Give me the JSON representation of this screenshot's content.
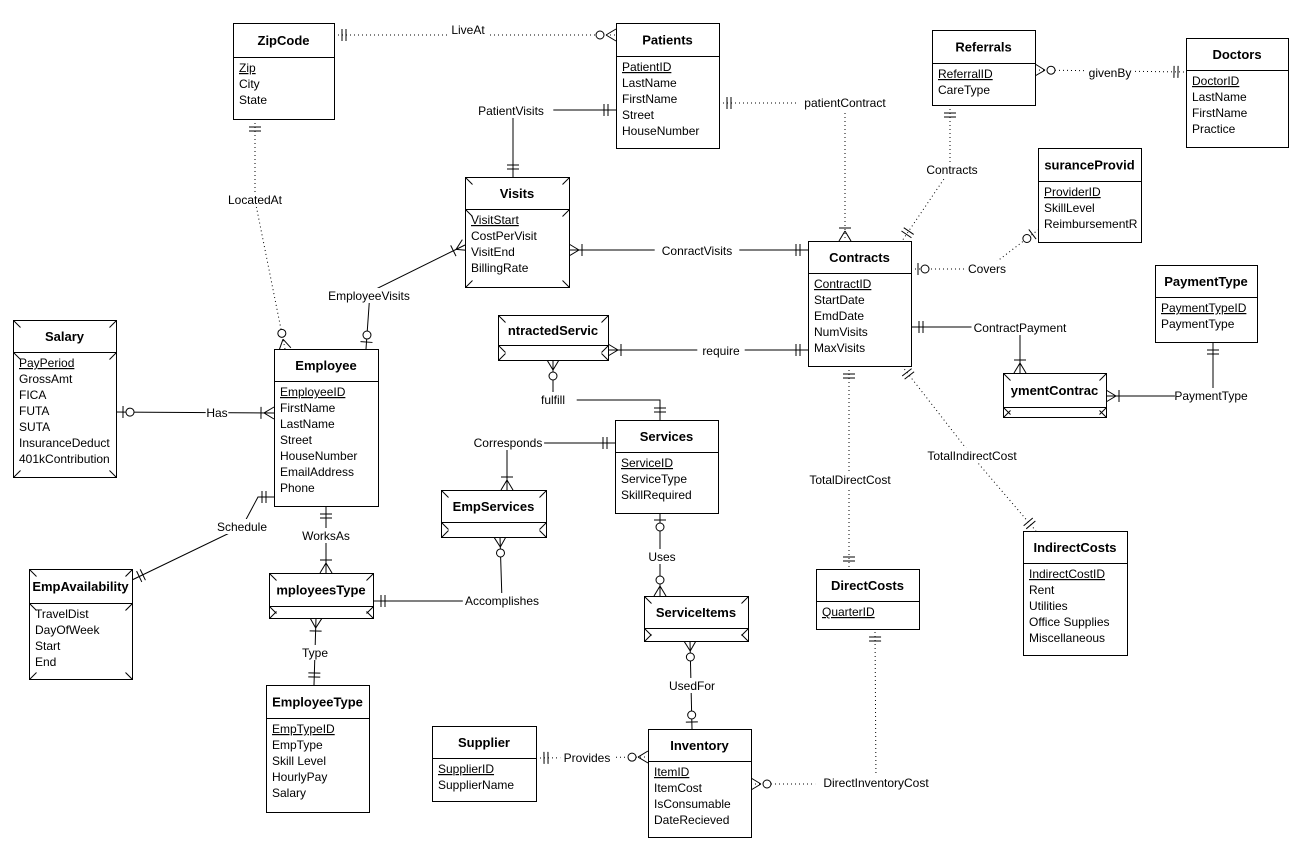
{
  "colors": {
    "line": "#000000",
    "background": "#ffffff",
    "box": "#ffffff"
  },
  "entities": [
    {
      "id": "zipcode",
      "name": "ZipCode",
      "attributes": [
        {
          "name": "Zip",
          "key": true
        },
        {
          "name": "City"
        },
        {
          "name": "State"
        }
      ]
    },
    {
      "id": "patients",
      "name": "Patients",
      "attributes": [
        {
          "name": "PatientID",
          "key": true
        },
        {
          "name": "LastName"
        },
        {
          "name": "FirstName"
        },
        {
          "name": "Street"
        },
        {
          "name": "HouseNumber"
        }
      ]
    },
    {
      "id": "referrals",
      "name": "Referrals",
      "attributes": [
        {
          "name": "ReferralID",
          "key": true
        },
        {
          "name": "CareType"
        }
      ]
    },
    {
      "id": "doctors",
      "name": "Doctors",
      "attributes": [
        {
          "name": "DoctorID",
          "key": true
        },
        {
          "name": "LastName"
        },
        {
          "name": "FirstName"
        },
        {
          "name": "Practice"
        }
      ]
    },
    {
      "id": "visits",
      "name": "Visits",
      "weak": true,
      "attributes": [
        {
          "name": "VisitStart",
          "key": true
        },
        {
          "name": "CostPerVisit"
        },
        {
          "name": "VisitEnd"
        },
        {
          "name": "BillingRate"
        }
      ]
    },
    {
      "id": "insurance",
      "name": "suranceProvid",
      "attributes": [
        {
          "name": "ProviderID",
          "key": true
        },
        {
          "name": "SkillLevel"
        },
        {
          "name": "ReimbursementR"
        }
      ]
    },
    {
      "id": "contracts",
      "name": "Contracts",
      "attributes": [
        {
          "name": "ContractID",
          "key": true
        },
        {
          "name": "StartDate"
        },
        {
          "name": "EmdDate"
        },
        {
          "name": "NumVisits"
        },
        {
          "name": "MaxVisits"
        }
      ]
    },
    {
      "id": "paymenttype",
      "name": "PaymentType",
      "attributes": [
        {
          "name": "PaymentTypeID",
          "key": true
        },
        {
          "name": "PaymentType"
        }
      ]
    },
    {
      "id": "salary",
      "name": "Salary",
      "weak": true,
      "attributes": [
        {
          "name": "PayPeriod",
          "key": true
        },
        {
          "name": "GrossAmt"
        },
        {
          "name": "FICA"
        },
        {
          "name": "FUTA"
        },
        {
          "name": "SUTA"
        },
        {
          "name": "InsuranceDeduct"
        },
        {
          "name": "401kContribution"
        }
      ]
    },
    {
      "id": "employee",
      "name": "Employee",
      "attributes": [
        {
          "name": "EmployeeID",
          "key": true
        },
        {
          "name": "FirstName"
        },
        {
          "name": "LastName"
        },
        {
          "name": "Street"
        },
        {
          "name": "HouseNumber"
        },
        {
          "name": "EmailAddress"
        },
        {
          "name": "Phone"
        }
      ]
    },
    {
      "id": "contractedservices",
      "name": "ntractedServic",
      "weak": true,
      "attributes": []
    },
    {
      "id": "paymentcontract",
      "name": "ymentContrac",
      "weak": true,
      "attributes": []
    },
    {
      "id": "services",
      "name": "Services",
      "attributes": [
        {
          "name": "ServiceID",
          "key": true
        },
        {
          "name": "ServiceType"
        },
        {
          "name": "SkillRequired"
        }
      ]
    },
    {
      "id": "empservices",
      "name": "EmpServices",
      "weak": true,
      "attributes": []
    },
    {
      "id": "empavailability",
      "name": "EmpAvailability",
      "weak": true,
      "attributes": [
        {
          "name": "TravelDist"
        },
        {
          "name": "DayOfWeek"
        },
        {
          "name": "Start"
        },
        {
          "name": "End"
        }
      ]
    },
    {
      "id": "employeestype",
      "name": "mployeesType",
      "weak": true,
      "attributes": []
    },
    {
      "id": "directcosts",
      "name": "DirectCosts",
      "attributes": [
        {
          "name": "QuarterID",
          "key": true
        }
      ]
    },
    {
      "id": "serviceitems",
      "name": "ServiceItems",
      "weak": true,
      "attributes": []
    },
    {
      "id": "indirectcosts",
      "name": "IndirectCosts",
      "attributes": [
        {
          "name": "IndirectCostID",
          "key": true
        },
        {
          "name": "Rent"
        },
        {
          "name": "Utilities"
        },
        {
          "name": "Office Supplies"
        },
        {
          "name": "Miscellaneous"
        }
      ]
    },
    {
      "id": "employeetype",
      "name": "EmployeeType",
      "attributes": [
        {
          "name": "EmpTypeID",
          "key": true
        },
        {
          "name": "EmpType"
        },
        {
          "name": "Skill Level"
        },
        {
          "name": "HourlyPay"
        },
        {
          "name": "Salary"
        }
      ]
    },
    {
      "id": "supplier",
      "name": "Supplier",
      "attributes": [
        {
          "name": "SupplierID",
          "key": true
        },
        {
          "name": "SupplierName"
        }
      ]
    },
    {
      "id": "inventory",
      "name": "Inventory",
      "attributes": [
        {
          "name": "ItemID",
          "key": true
        },
        {
          "name": "ItemCost"
        },
        {
          "name": "IsConsumable"
        },
        {
          "name": "DateRecieved"
        }
      ]
    }
  ],
  "relationships": [
    {
      "id": "liveat",
      "label": "LiveAt",
      "dotted": true,
      "start": "one",
      "end": "zmany"
    },
    {
      "id": "patientvisits",
      "label": "PatientVisits",
      "start": "one",
      "end": "one"
    },
    {
      "id": "patientcontract",
      "label": "patientContract",
      "dotted": true,
      "start": "one",
      "end": "many"
    },
    {
      "id": "locatedat",
      "label": "LocatedAt",
      "dotted": true,
      "start": "one",
      "end": "zmany"
    },
    {
      "id": "employeevisits",
      "label": "EmployeeVisits",
      "start": "many",
      "end": "zone"
    },
    {
      "id": "conractvisits",
      "label": "ConractVisits",
      "start": "many",
      "end": "one"
    },
    {
      "id": "contractsrel",
      "label": "Contracts",
      "dotted": true,
      "start": "one",
      "end": "one"
    },
    {
      "id": "givenby",
      "label": "givenBy",
      "dotted": true,
      "start": "zmany",
      "end": "one"
    },
    {
      "id": "covers",
      "label": "Covers",
      "dotted": true,
      "start": "zone",
      "end": "zone"
    },
    {
      "id": "contractpayment",
      "label": "ContractPayment",
      "start": "one",
      "end": "many"
    },
    {
      "id": "paymenttyperel",
      "label": "PaymentType",
      "start": "many",
      "end": "one"
    },
    {
      "id": "require",
      "label": "require",
      "start": "many",
      "end": "one"
    },
    {
      "id": "fulfill",
      "label": "fulfill",
      "start": "zmany",
      "end": "one"
    },
    {
      "id": "corresponds",
      "label": "Corresponds",
      "start": "many",
      "end": "one"
    },
    {
      "id": "has",
      "label": "Has",
      "start": "zone",
      "end": "many"
    },
    {
      "id": "schedule",
      "label": "Schedule",
      "start": "one",
      "end": "one"
    },
    {
      "id": "worksas",
      "label": "WorksAs",
      "start": "one",
      "end": "many"
    },
    {
      "id": "type",
      "label": "Type",
      "start": "many",
      "end": "one"
    },
    {
      "id": "accomplishes",
      "label": "Accomplishes",
      "start": "one",
      "end": "zmany"
    },
    {
      "id": "uses",
      "label": "Uses",
      "start": "zone",
      "end": "zmany"
    },
    {
      "id": "usedfor",
      "label": "UsedFor",
      "start": "zmany",
      "end": "zone"
    },
    {
      "id": "provides",
      "label": "Provides",
      "dotted": true,
      "start": "one",
      "end": "zmany"
    },
    {
      "id": "directinventorycost",
      "label": "DirectInventoryCost",
      "dotted": true,
      "start": "zmany",
      "end": "one"
    },
    {
      "id": "totaldirectcost",
      "label": "TotalDirectCost",
      "dotted": true,
      "start": "one",
      "end": "one"
    },
    {
      "id": "totalindirectcost",
      "label": "TotalIndirectCost",
      "dotted": true,
      "start": "one",
      "end": "one"
    }
  ]
}
